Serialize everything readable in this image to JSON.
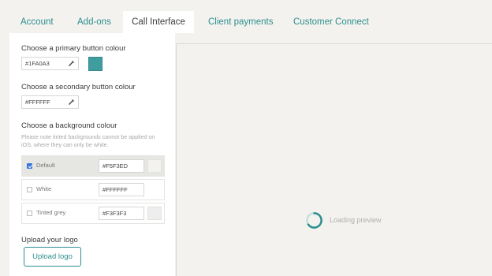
{
  "tabs": [
    {
      "label": "Account",
      "active": false
    },
    {
      "label": "Add-ons",
      "active": false
    },
    {
      "label": "Call Interface",
      "active": true
    },
    {
      "label": "Client payments",
      "active": false
    },
    {
      "label": "Customer Connect",
      "active": false
    }
  ],
  "primary": {
    "label": "Choose a primary button colour",
    "value": "#1FA0A3",
    "swatch_color": "#3f9c9f"
  },
  "secondary": {
    "label": "Choose a secondary button colour",
    "value": "#FFFFFF"
  },
  "background": {
    "label": "Choose a background colour",
    "note": "Please note tinted backgrounds cannot be applied on iOS, where they can only be white.",
    "options": [
      {
        "name": "Default",
        "value": "#F5F3ED",
        "checked": true,
        "swatch_color": "#f3f2ee"
      },
      {
        "name": "White",
        "value": "#FFFFFF",
        "checked": false,
        "swatch_color": "#ffffff"
      },
      {
        "name": "Tinted grey",
        "value": "#F3F3F3",
        "checked": false,
        "swatch_color": "#eeeeee"
      }
    ]
  },
  "logo": {
    "label": "Upload your logo",
    "button": "Upload logo"
  },
  "preview": {
    "loading_text": "Loading preview"
  },
  "colors": {
    "accent": "#2d8f8f",
    "page_bg": "#f3f2ee",
    "checkbox": "#3b74d9"
  }
}
